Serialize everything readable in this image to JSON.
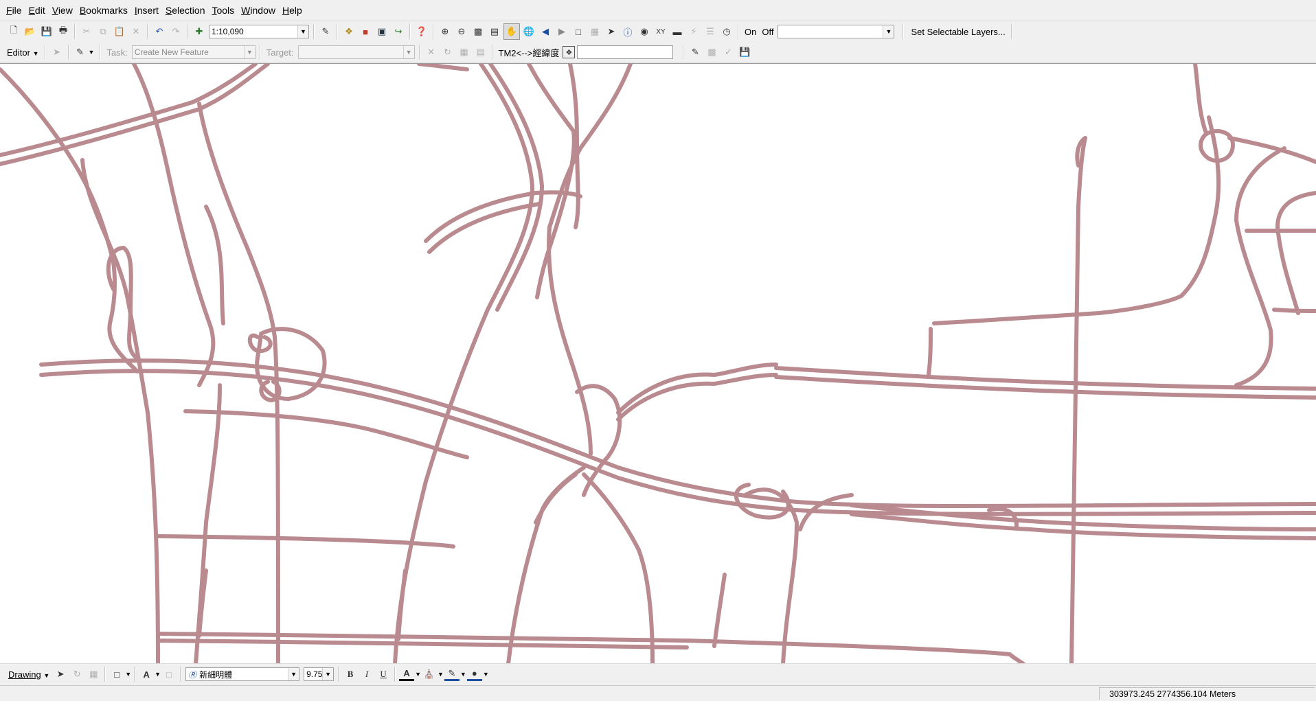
{
  "menu": [
    "File",
    "Edit",
    "View",
    "Bookmarks",
    "Insert",
    "Selection",
    "Tools",
    "Window",
    "Help"
  ],
  "menu_accel": [
    "F",
    "E",
    "V",
    "B",
    "I",
    "S",
    "T",
    "W",
    "H"
  ],
  "standard_toolbar": {
    "scale": "1:10,090",
    "on_label": "On",
    "off_label": "Off",
    "layer_combo_value": "",
    "set_selectable_label": "Set Selectable Layers..."
  },
  "editor_toolbar": {
    "editor_label": "Editor",
    "task_label": "Task:",
    "task_value": "Create New Feature",
    "target_label": "Target:",
    "target_value": "",
    "tm2_label": "TM2<-->經緯度",
    "coord_input": ""
  },
  "drawing_toolbar": {
    "drawing_label": "Drawing",
    "font_name": "新細明體",
    "font_size": "9.75",
    "bold": "B",
    "italic": "I",
    "underline": "U"
  },
  "status": {
    "coordinates": "303973.245  2774356.104 Meters"
  },
  "colors": {
    "road_outline": "#9c6f75",
    "road_fill": "#f4d6d8",
    "map_background": "#ffffff"
  }
}
